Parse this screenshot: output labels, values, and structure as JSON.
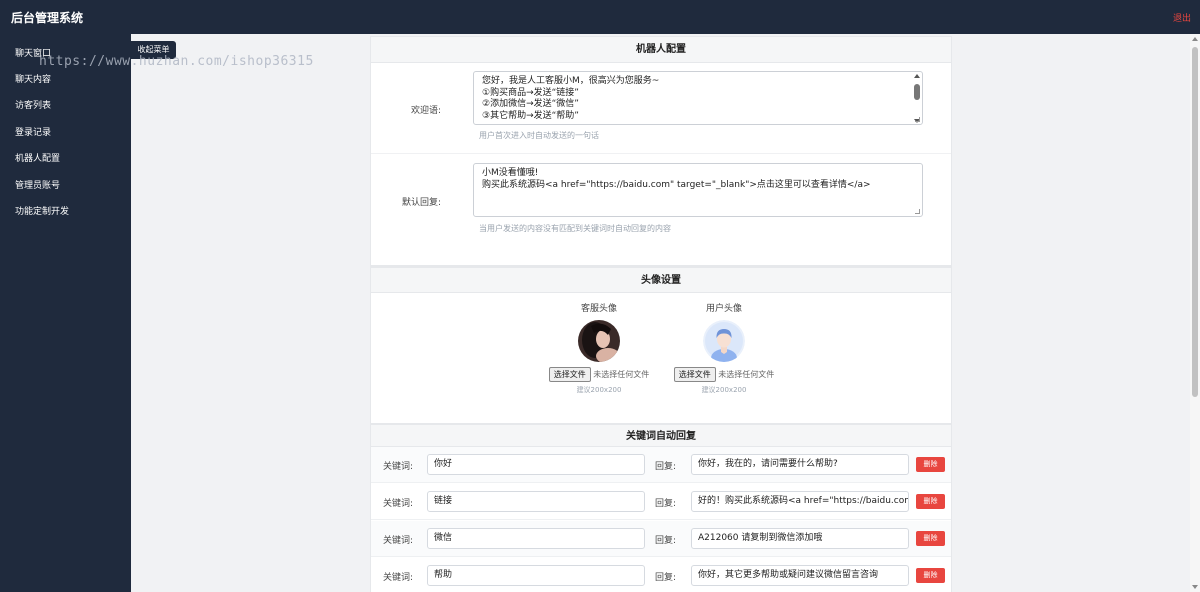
{
  "app": {
    "title": "后台管理系统",
    "logout_label": "退出"
  },
  "watermark": "https://www.huzhan.com/ishop36315",
  "sidebar": {
    "collapse_label": "收起菜单",
    "items": [
      {
        "label": "聊天窗口"
      },
      {
        "label": "聊天内容"
      },
      {
        "label": "访客列表"
      },
      {
        "label": "登录记录"
      },
      {
        "label": "机器人配置"
      },
      {
        "label": "管理员账号"
      },
      {
        "label": "功能定制开发"
      }
    ]
  },
  "robot": {
    "title": "机器人配置",
    "welcome": {
      "label": "欢迎语:",
      "lines": [
        "您好，我是人工客服小M，很高兴为您服务~",
        "①购买商品→发送“链接”",
        "②添加微信→发送“微信”",
        "③其它帮助→发送“帮助”"
      ],
      "hint": "用户首次进入时自动发送的一句话"
    },
    "default_reply": {
      "label": "默认回复:",
      "lines": [
        "小M没看懂哦!",
        "购买此系统源码<a href=\"https://baidu.com\" target=\"_blank\">点击这里可以查看详情</a>"
      ],
      "hint": "当用户发送的内容没有匹配到关键词时自动回复的内容"
    }
  },
  "avatars": {
    "title": "头像设置",
    "agent": {
      "label": "客服头像",
      "file_button": "选择文件",
      "file_status": "未选择任何文件",
      "hint": "建议200x200"
    },
    "user": {
      "label": "用户头像",
      "file_button": "选择文件",
      "file_status": "未选择任何文件",
      "hint": "建议200x200"
    }
  },
  "keywords": {
    "title": "关键词自动回复",
    "keyword_label": "关键词:",
    "reply_label": "回复:",
    "delete_label": "删除",
    "rows": [
      {
        "keyword": "你好",
        "reply": "你好，我在的，请问需要什么帮助?"
      },
      {
        "keyword": "链接",
        "reply": "好的！购买此系统源码<a href=\"https://baidu.com"
      },
      {
        "keyword": "微信",
        "reply": "A212060 请复制到微信添加哦"
      },
      {
        "keyword": "帮助",
        "reply": "你好，其它更多帮助或疑问建议微信留言咨询"
      }
    ]
  }
}
